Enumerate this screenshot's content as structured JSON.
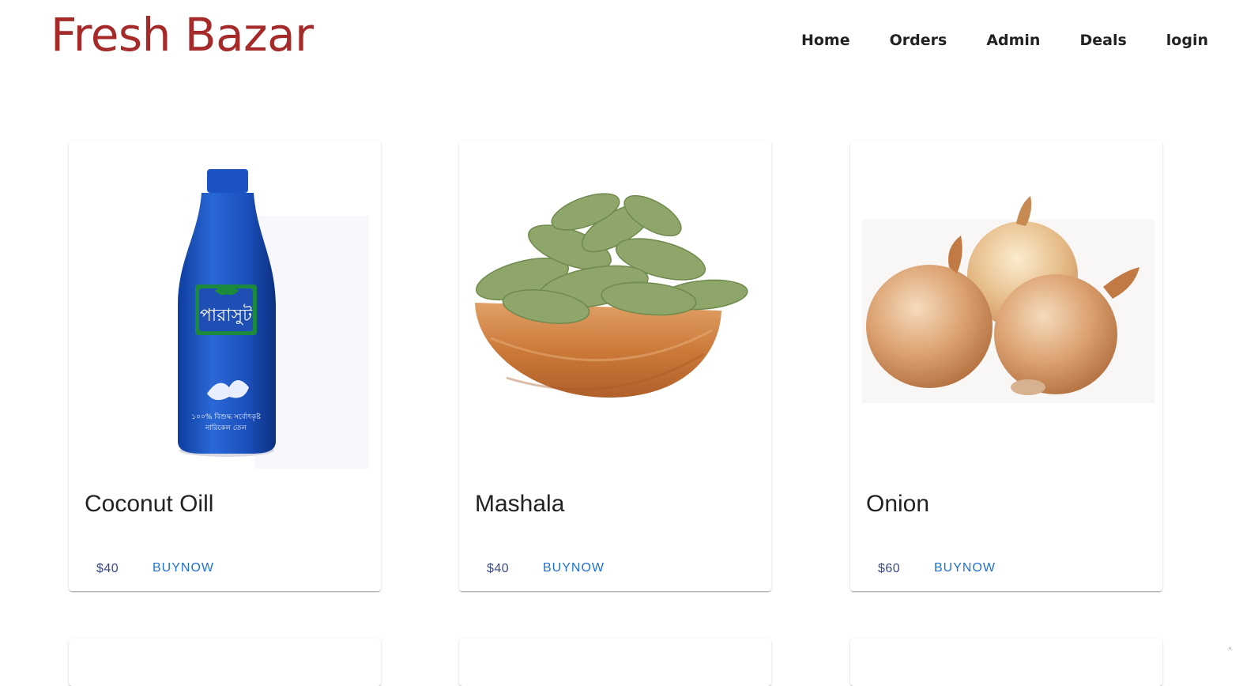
{
  "header": {
    "brand": "Fresh Bazar",
    "nav": [
      "Home",
      "Orders",
      "Admin",
      "Deals",
      "login"
    ]
  },
  "products": [
    {
      "name": "Coconut Oill",
      "price": "$40",
      "action": "BUYNOW"
    },
    {
      "name": "Mashala",
      "price": "$40",
      "action": "BUYNOW"
    },
    {
      "name": "Onion",
      "price": "$60",
      "action": "BUYNOW"
    }
  ],
  "colors": {
    "brand": "#a52a2a",
    "link": "#1e70d6",
    "price": "#3b4a8a"
  },
  "scroll_indicator": "^"
}
